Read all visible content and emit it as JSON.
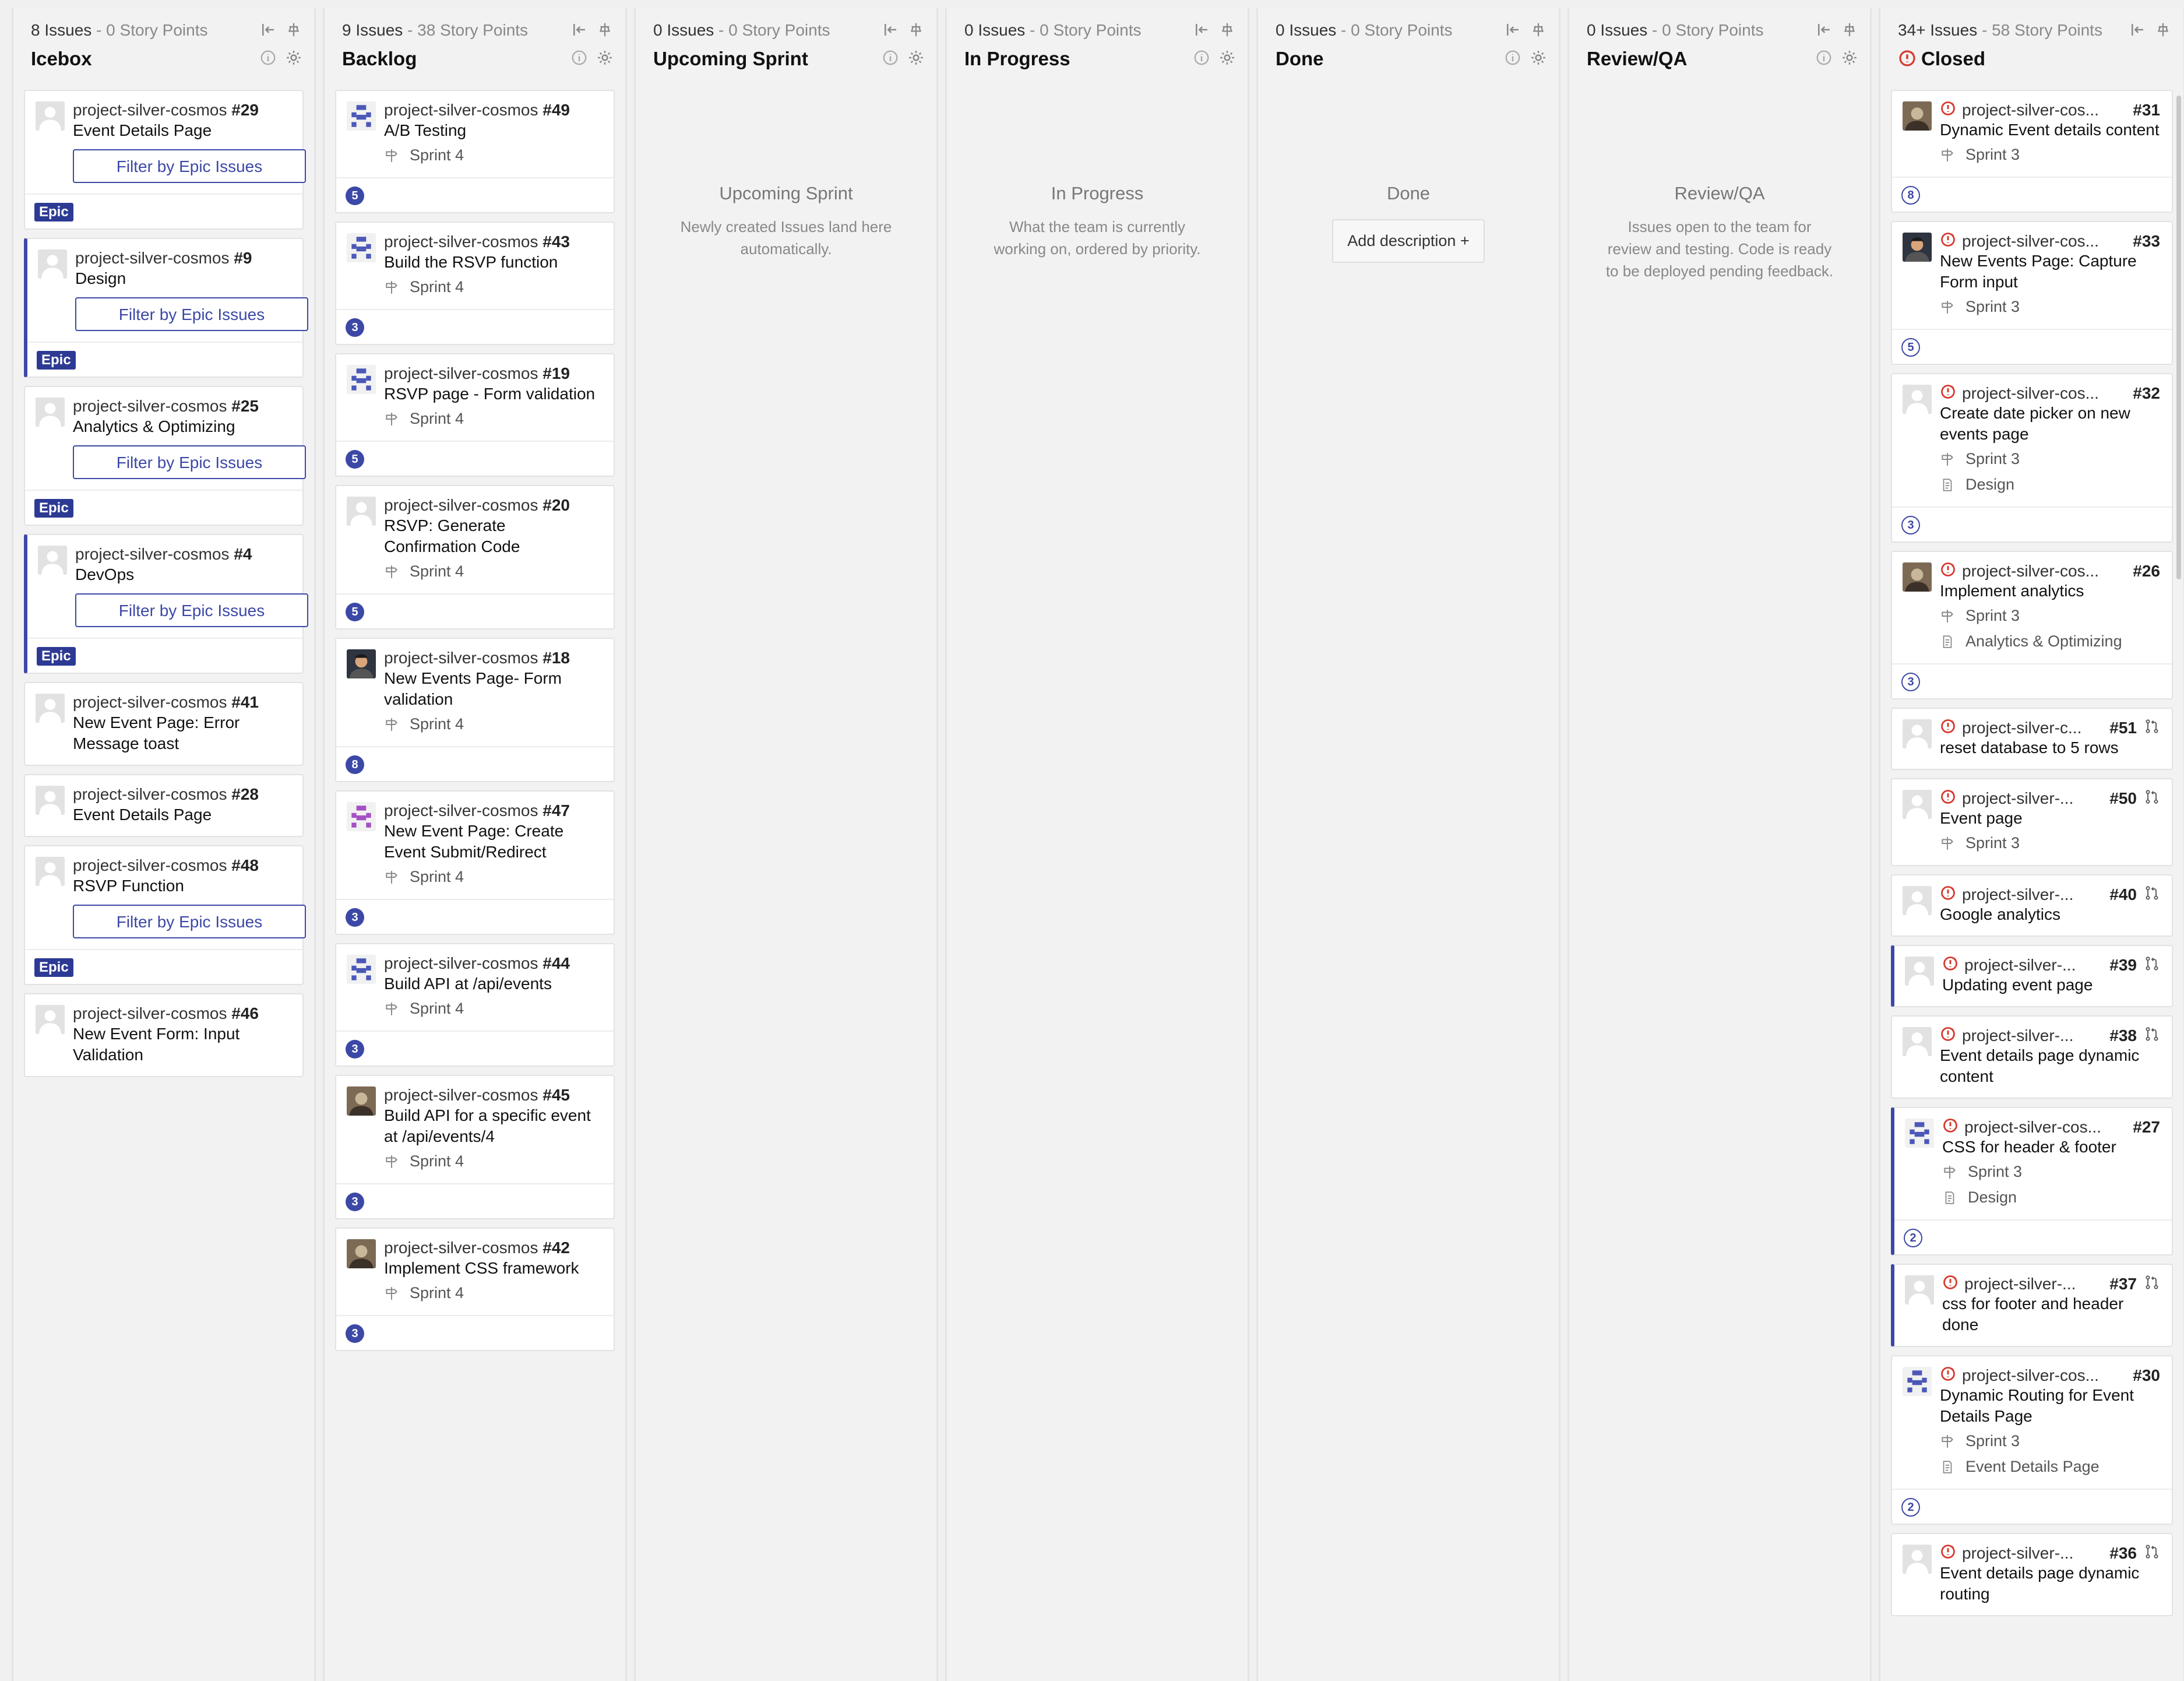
{
  "columns": [
    {
      "meta_issues": "8 Issues",
      "meta_points": " - 0 Story Points",
      "title": "Icebox"
    },
    {
      "meta_issues": "9 Issues",
      "meta_points": " - 38 Story Points",
      "title": "Backlog"
    },
    {
      "meta_issues": "0 Issues",
      "meta_points": " - 0 Story Points",
      "title": "Upcoming Sprint"
    },
    {
      "meta_issues": "0 Issues",
      "meta_points": " - 0 Story Points",
      "title": "In Progress"
    },
    {
      "meta_issues": "0 Issues",
      "meta_points": " - 0 Story Points",
      "title": "Done"
    },
    {
      "meta_issues": "0 Issues",
      "meta_points": " - 0 Story Points",
      "title": "Review/QA"
    },
    {
      "meta_issues": "34+ Issues",
      "meta_points": " - 58 Story Points",
      "title": "Closed"
    }
  ],
  "icebox": [
    {
      "repo": "project-silver-cosmos",
      "num": "#29",
      "title": "Event Details Page",
      "filter": "Filter by Epic Issues",
      "epic": "Epic",
      "bar": false
    },
    {
      "repo": "project-silver-cosmos",
      "num": "#9",
      "title": "Design",
      "filter": "Filter by Epic Issues",
      "epic": "Epic",
      "bar": true
    },
    {
      "repo": "project-silver-cosmos",
      "num": "#25",
      "title": "Analytics & Optimizing",
      "filter": "Filter by Epic Issues",
      "epic": "Epic",
      "bar": false
    },
    {
      "repo": "project-silver-cosmos",
      "num": "#4",
      "title": "DevOps",
      "filter": "Filter by Epic Issues",
      "epic": "Epic",
      "bar": true
    },
    {
      "repo": "project-silver-cosmos",
      "num": "#41",
      "title": "New Event Page: Error Message toast"
    },
    {
      "repo": "project-silver-cosmos",
      "num": "#28",
      "title": "Event Details Page"
    },
    {
      "repo": "project-silver-cosmos",
      "num": "#48",
      "title": "RSVP Function",
      "filter": "Filter by Epic Issues",
      "epic": "Epic",
      "bar": false
    },
    {
      "repo": "project-silver-cosmos",
      "num": "#46",
      "title": "New Event Form: Input Validation"
    }
  ],
  "backlog": [
    {
      "repo": "project-silver-cosmos",
      "num": "#49",
      "title": "A/B Testing",
      "sprint": "Sprint 4",
      "points": "5",
      "avatar": "blue"
    },
    {
      "repo": "project-silver-cosmos",
      "num": "#43",
      "title": "Build the RSVP function",
      "sprint": "Sprint 4",
      "points": "3",
      "avatar": "blue"
    },
    {
      "repo": "project-silver-cosmos",
      "num": "#19",
      "title": "RSVP page - Form validation",
      "sprint": "Sprint 4",
      "points": "5",
      "avatar": "blue"
    },
    {
      "repo": "project-silver-cosmos",
      "num": "#20",
      "title": "RSVP: Generate Confirmation Code",
      "sprint": "Sprint 4",
      "points": "5",
      "avatar": "default"
    },
    {
      "repo": "project-silver-cosmos",
      "num": "#18",
      "title": "New Events Page- Form validation",
      "sprint": "Sprint 4",
      "points": "8",
      "avatar": "photo2"
    },
    {
      "repo": "project-silver-cosmos",
      "num": "#47",
      "title": "New Event Page: Create Event Submit/Redirect",
      "sprint": "Sprint 4",
      "points": "3",
      "avatar": "purple"
    },
    {
      "repo": "project-silver-cosmos",
      "num": "#44",
      "title": "Build API at /api/events",
      "sprint": "Sprint 4",
      "points": "3",
      "avatar": "blue"
    },
    {
      "repo": "project-silver-cosmos",
      "num": "#45",
      "title": "Build API for a specific event at /api/events/4",
      "sprint": "Sprint 4",
      "points": "3",
      "avatar": "photo1"
    },
    {
      "repo": "project-silver-cosmos",
      "num": "#42",
      "title": "Implement CSS framework",
      "sprint": "Sprint 4",
      "points": "3",
      "avatar": "photo1"
    }
  ],
  "empty": {
    "upcoming": {
      "title": "Upcoming Sprint",
      "desc": "Newly created Issues land here automatically."
    },
    "progress": {
      "title": "In Progress",
      "desc": "What the team is currently working on, ordered by priority."
    },
    "done": {
      "title": "Done",
      "button": "Add description +"
    },
    "review": {
      "title": "Review/QA",
      "desc": "Issues open to the team for review and testing. Code is ready to be deployed pending feedback."
    }
  },
  "closed": [
    {
      "repo": "project-silver-cos...",
      "num": "#31",
      "title": "Dynamic Event details content",
      "sprint": "Sprint 3",
      "points": "8",
      "avatar": "photo1",
      "pr": false
    },
    {
      "repo": "project-silver-cos...",
      "num": "#33",
      "title": "New Events Page: Capture Form input",
      "sprint": "Sprint 3",
      "points": "5",
      "avatar": "photo2",
      "pr": false
    },
    {
      "repo": "project-silver-cos...",
      "num": "#32",
      "title": "Create date picker on new events page",
      "sprint": "Sprint 3",
      "epic_link": "Design",
      "points": "3",
      "avatar": "default",
      "pr": false
    },
    {
      "repo": "project-silver-cos...",
      "num": "#26",
      "title": "Implement analytics",
      "sprint": "Sprint 3",
      "epic_link": "Analytics & Optimizing",
      "points": "3",
      "avatar": "photo1",
      "pr": false
    },
    {
      "repo": "project-silver-c...",
      "num": "#51",
      "title": "reset database to 5 rows",
      "avatar": "default",
      "pr": true
    },
    {
      "repo": "project-silver-...",
      "num": "#50",
      "title": "Event page",
      "sprint": "Sprint 3",
      "avatar": "default",
      "pr": true
    },
    {
      "repo": "project-silver-...",
      "num": "#40",
      "title": "Google analytics",
      "avatar": "default",
      "pr": true
    },
    {
      "repo": "project-silver-...",
      "num": "#39",
      "title": "Updating event page",
      "avatar": "default",
      "pr": true,
      "bar": true
    },
    {
      "repo": "project-silver-...",
      "num": "#38",
      "title": "Event details page dynamic content",
      "avatar": "default",
      "pr": true
    },
    {
      "repo": "project-silver-cos...",
      "num": "#27",
      "title": "CSS for header & footer",
      "sprint": "Sprint 3",
      "epic_link": "Design",
      "points": "2",
      "avatar": "blue",
      "pr": false,
      "bar": true
    },
    {
      "repo": "project-silver-...",
      "num": "#37",
      "title": "css for footer and header done",
      "avatar": "default",
      "pr": true,
      "bar": true
    },
    {
      "repo": "project-silver-cos...",
      "num": "#30",
      "title": "Dynamic Routing for Event Details Page",
      "sprint": "Sprint 3",
      "epic_link": "Event Details Page",
      "points": "2",
      "avatar": "blue",
      "pr": false
    },
    {
      "repo": "project-silver-...",
      "num": "#36",
      "title": "Event details page dynamic routing",
      "avatar": "default",
      "pr": true
    }
  ],
  "colors": {
    "accent": "#3c48a6",
    "closed_red": "#d73a2f",
    "epic_bg": "#2d3a94"
  }
}
